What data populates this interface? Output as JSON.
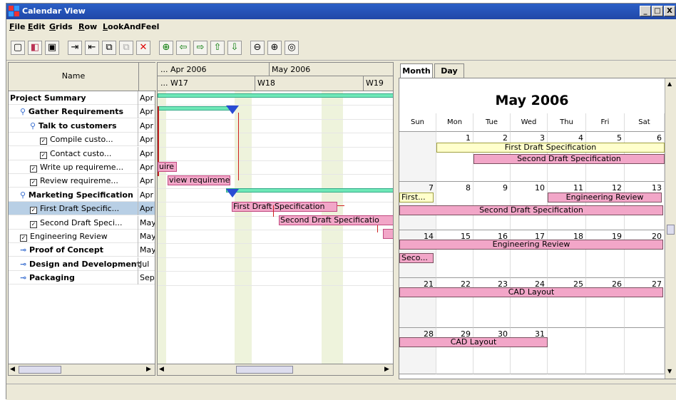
{
  "window": {
    "title": "Calendar View",
    "buttons": [
      "_",
      "□",
      "X"
    ]
  },
  "menu": [
    "File",
    "Edit",
    "Grids",
    "Row",
    "LookAndFeel"
  ],
  "toolbar": {
    "icons": [
      "new-icon",
      "open-icon",
      "save-icon",
      "indent-icon",
      "outdent-icon",
      "link-icon",
      "unlink-icon",
      "delete-icon",
      "insert-row-icon",
      "move-left-icon",
      "move-right-icon",
      "move-up-icon",
      "move-down-icon",
      "zoom-out-icon",
      "zoom-in-icon",
      "zoom-fit-icon"
    ]
  },
  "tree": {
    "header": "Name",
    "rows": [
      {
        "label": "Project Summary",
        "start": "Apr",
        "bold": true,
        "indent": 0,
        "icon": "none"
      },
      {
        "label": "Gather Requirements",
        "start": "Apr",
        "bold": true,
        "indent": 1,
        "icon": "expand"
      },
      {
        "label": "Talk to customers",
        "start": "Apr",
        "bold": true,
        "indent": 2,
        "icon": "expand"
      },
      {
        "label": "Compile custo...",
        "start": "Apr",
        "bold": false,
        "indent": 3,
        "icon": "task"
      },
      {
        "label": "Contact custo...",
        "start": "Apr",
        "bold": false,
        "indent": 3,
        "icon": "task"
      },
      {
        "label": "Write up requireme...",
        "start": "Apr",
        "bold": false,
        "indent": 2,
        "icon": "task"
      },
      {
        "label": "Review requireme...",
        "start": "Apr",
        "bold": false,
        "indent": 2,
        "icon": "task"
      },
      {
        "label": "Marketing Specification",
        "start": "Apr",
        "bold": true,
        "indent": 1,
        "icon": "expand"
      },
      {
        "label": "First Draft Specific...",
        "start": "Apr",
        "bold": false,
        "indent": 2,
        "icon": "task",
        "selected": true
      },
      {
        "label": "Second Draft Speci...",
        "start": "May",
        "bold": false,
        "indent": 2,
        "icon": "task"
      },
      {
        "label": "Engineering Review",
        "start": "May",
        "bold": false,
        "indent": 1,
        "icon": "task"
      },
      {
        "label": "Proof of Concept",
        "start": "May",
        "bold": true,
        "indent": 1,
        "icon": "collapsed"
      },
      {
        "label": "Design and Development",
        "start": "Jul",
        "bold": true,
        "indent": 1,
        "icon": "collapsed"
      },
      {
        "label": "Packaging",
        "start": "Sep",
        "bold": true,
        "indent": 1,
        "icon": "collapsed"
      }
    ]
  },
  "gantt": {
    "months": [
      "... Apr 2006",
      "May 2006"
    ],
    "weeks": [
      "... W17",
      "W18",
      "W19"
    ],
    "bars": {
      "write_up": "uire",
      "review": "view requireme",
      "first_draft": "First Draft Specification",
      "second_draft": "Second Draft Specificatio"
    }
  },
  "calendar": {
    "tabs": [
      "Month",
      "Day"
    ],
    "title": "May 2006",
    "weekdays": [
      "Sun",
      "Mon",
      "Tue",
      "Wed",
      "Thu",
      "Fri",
      "Sat"
    ],
    "weeks": [
      [
        "",
        "1",
        "2",
        "3",
        "4",
        "5",
        "6"
      ],
      [
        "7",
        "8",
        "9",
        "10",
        "11",
        "12",
        "13"
      ],
      [
        "14",
        "15",
        "16",
        "17",
        "18",
        "19",
        "20"
      ],
      [
        "21",
        "22",
        "23",
        "24",
        "25",
        "26",
        "27"
      ],
      [
        "28",
        "29",
        "30",
        "31",
        "",
        "",
        ""
      ]
    ],
    "events": {
      "e1": "First Draft Specification",
      "e2": "Second Draft Specification",
      "e3": "First...",
      "e4": "Engineering Review",
      "e5": "Second Draft Specification",
      "e6": "Engineering Review",
      "e7": "Seco...",
      "e8": "CAD Layout",
      "e9": "CAD Layout"
    }
  }
}
